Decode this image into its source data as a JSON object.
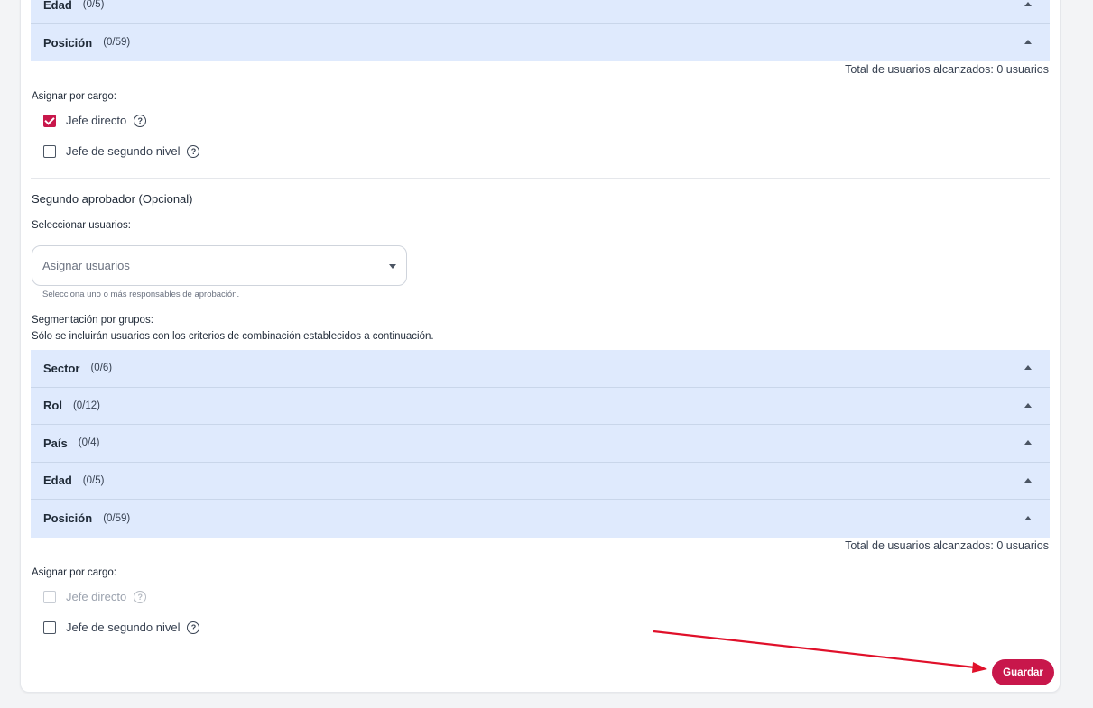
{
  "top_accordion": [
    {
      "name": "Edad",
      "count": "(0/5)"
    },
    {
      "name": "Posición",
      "count": "(0/59)"
    }
  ],
  "first_total": "Total de usuarios alcanzados: 0 usuarios",
  "first_assign": {
    "label": "Asignar por cargo:",
    "options": [
      {
        "label": "Jefe directo",
        "checked": true
      },
      {
        "label": "Jefe de segundo nivel",
        "checked": false
      }
    ]
  },
  "second_approver": {
    "title": "Segundo aprobador (Opcional)",
    "select_users_label": "Seleccionar usuarios:",
    "select_placeholder": "Asignar usuarios",
    "helper": "Selecciona uno o más responsables de aprobación.",
    "segmentation_label": "Segmentación por grupos:",
    "segmentation_desc": "Sólo se incluirán usuarios con los criterios de combinación establecidos a continuación.",
    "groups": [
      {
        "name": "Sector",
        "count": "(0/6)"
      },
      {
        "name": "Rol",
        "count": "(0/12)"
      },
      {
        "name": "País",
        "count": "(0/4)"
      },
      {
        "name": "Edad",
        "count": "(0/5)"
      },
      {
        "name": "Posición",
        "count": "(0/59)"
      }
    ],
    "total": "Total de usuarios alcanzados: 0 usuarios",
    "assign_label": "Asignar por cargo:",
    "options": [
      {
        "label": "Jefe directo",
        "checked": false,
        "disabled": true
      },
      {
        "label": "Jefe de segundo nivel",
        "checked": false,
        "disabled": false
      }
    ]
  },
  "save_label": "Guardar",
  "colors": {
    "accent": "#c8174b",
    "accordion_bg": "#dfeafd",
    "annotation_arrow": "#e0102a"
  },
  "icons": {
    "help": "question-circle-icon",
    "caret": "caret-up-icon",
    "dropdown": "caret-down-icon"
  }
}
